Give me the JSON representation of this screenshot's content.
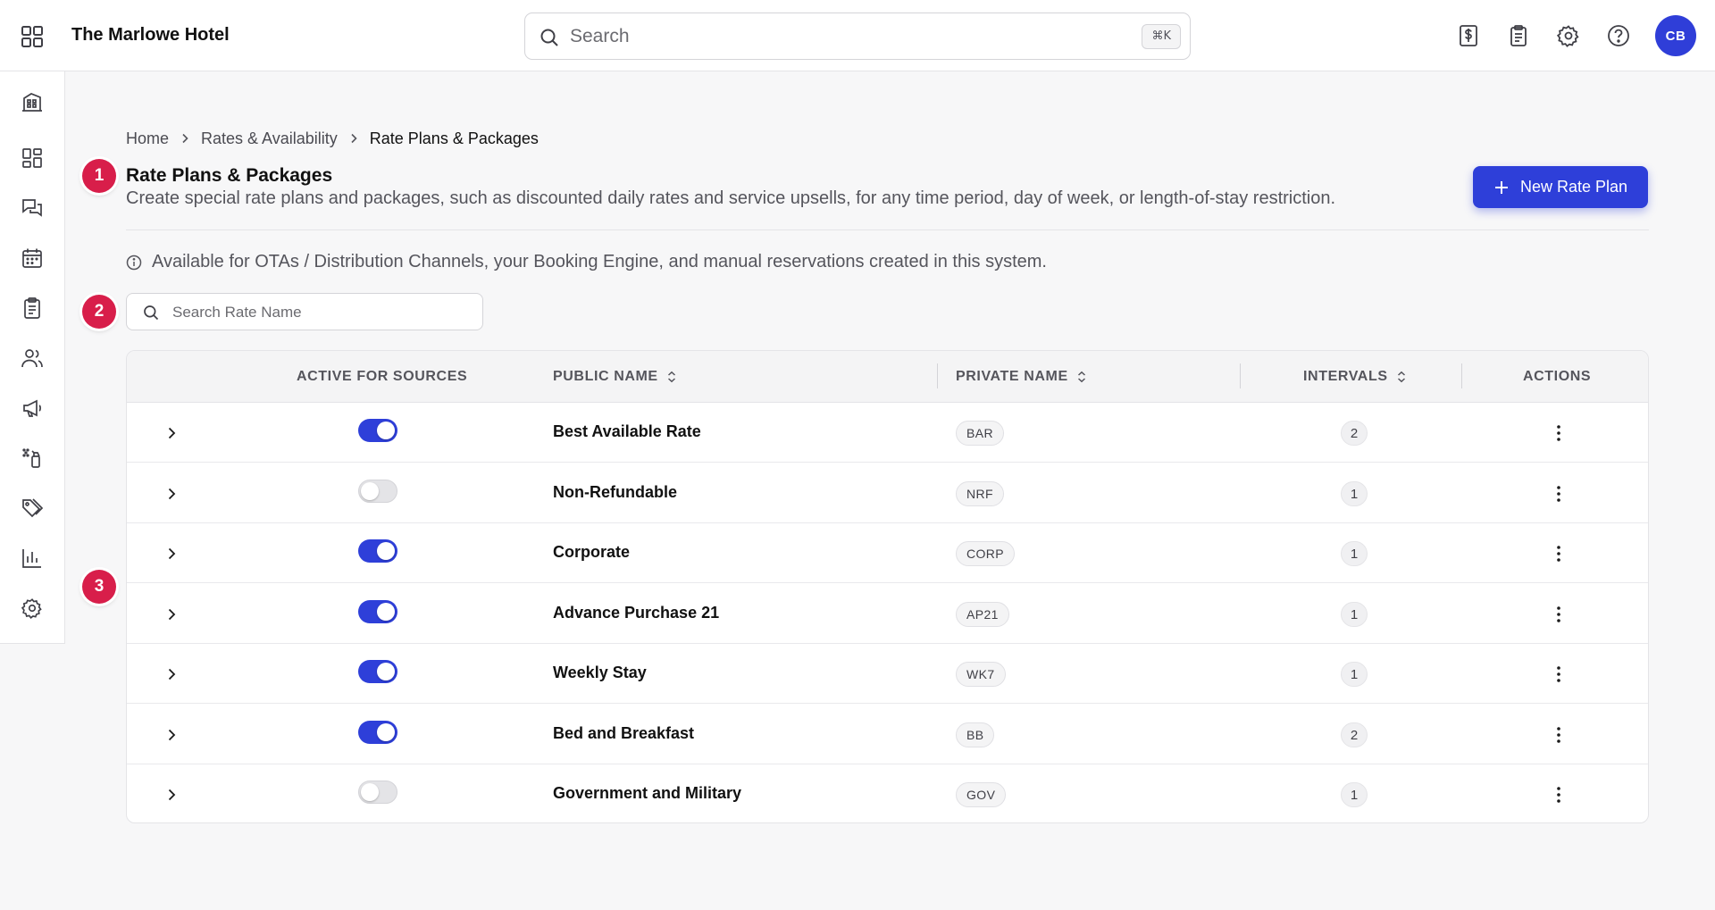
{
  "app": {
    "hotel_name": "The Marlowe Hotel",
    "search_placeholder": "Search",
    "search_shortcut": "⌘K",
    "user_initials": "CB"
  },
  "top_icons": [
    "dollar-receipt-icon",
    "clipboard-icon",
    "gear-icon",
    "help-circle-icon"
  ],
  "sidebar": {
    "items": [
      {
        "icon": "building-icon"
      },
      {
        "icon": "dashboard-grid-icon"
      },
      {
        "icon": "chat-bubbles-icon"
      },
      {
        "icon": "calendar-icon"
      },
      {
        "icon": "clipboard-list-icon"
      },
      {
        "icon": "users-icon"
      },
      {
        "icon": "megaphone-icon"
      },
      {
        "icon": "cleaning-spray-icon"
      },
      {
        "icon": "tags-icon"
      },
      {
        "icon": "bar-chart-icon"
      },
      {
        "icon": "gear-icon"
      }
    ]
  },
  "breadcrumb": {
    "home": "Home",
    "section": "Rates & Availability",
    "current": "Rate Plans & Packages"
  },
  "markers": {
    "one": "1",
    "two": "2",
    "three": "3"
  },
  "page": {
    "title": "Rate Plans & Packages",
    "description": "Create special rate plans and packages, such as discounted daily rates and service upsells, for any time period, day of week, or length-of-stay restriction.",
    "new_button": "New Rate Plan",
    "info": "Available for OTAs / Distribution Channels, your Booking Engine, and manual reservations created in this system.",
    "rate_search_placeholder": "Search Rate Name"
  },
  "table": {
    "headers": {
      "active": "ACTIVE FOR SOURCES",
      "public": "PUBLIC NAME",
      "private": "PRIVATE NAME",
      "intervals": "INTERVALS",
      "actions": "ACTIONS"
    },
    "rows": [
      {
        "public_name": "Best Available Rate",
        "private_name": "BAR",
        "intervals": "2",
        "active": true
      },
      {
        "public_name": "Non-Refundable",
        "private_name": "NRF",
        "intervals": "1",
        "active": false
      },
      {
        "public_name": "Corporate",
        "private_name": "CORP",
        "intervals": "1",
        "active": true
      },
      {
        "public_name": "Advance Purchase 21",
        "private_name": "AP21",
        "intervals": "1",
        "active": true
      },
      {
        "public_name": "Weekly Stay",
        "private_name": "WK7",
        "intervals": "1",
        "active": true
      },
      {
        "public_name": "Bed and Breakfast",
        "private_name": "BB",
        "intervals": "2",
        "active": true
      },
      {
        "public_name": "Government and Military",
        "private_name": "GOV",
        "intervals": "1",
        "active": false
      }
    ]
  },
  "colors": {
    "accent": "#2e3fd9",
    "marker": "#d81e4a",
    "avatar": "#2f3ed8"
  }
}
